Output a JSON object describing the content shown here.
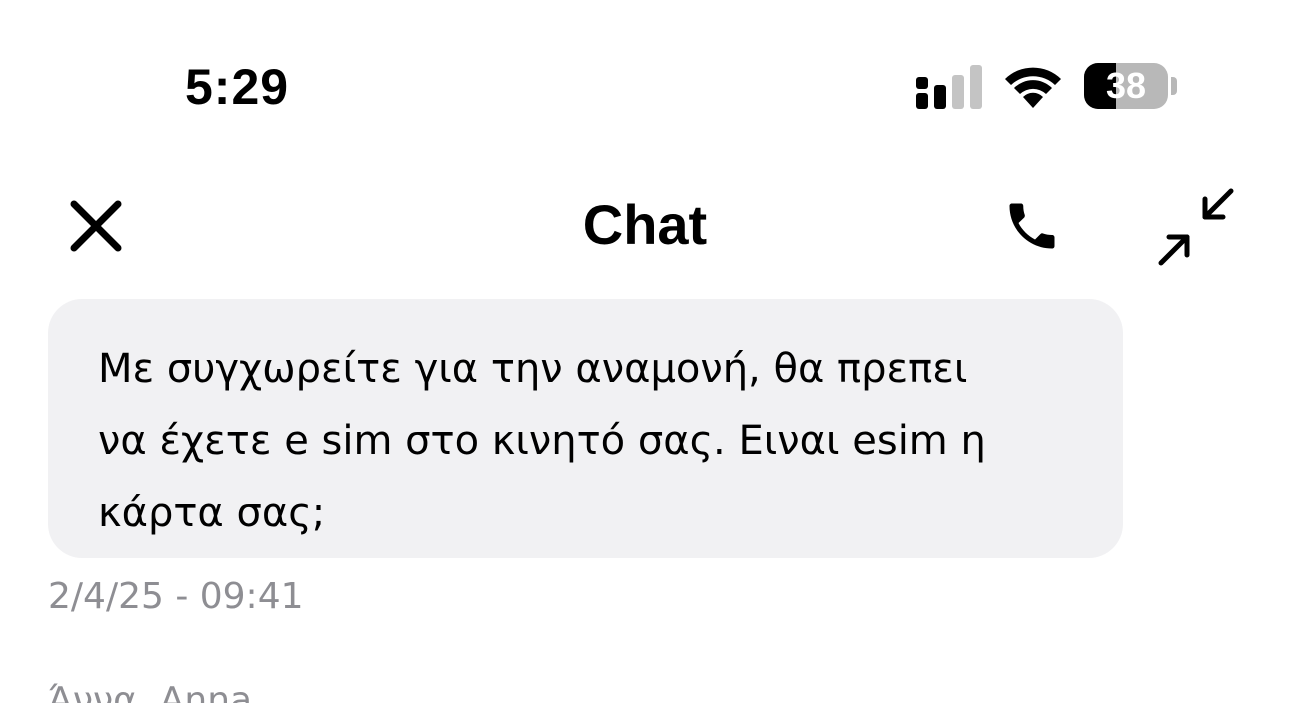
{
  "status_bar": {
    "time": "5:29",
    "battery_percent": "38",
    "battery_level": 0.38,
    "signal_bars_active": 2,
    "signal_bars_total": 4
  },
  "header": {
    "title": "Chat",
    "close_icon": "close-icon",
    "call_icon": "phone-icon",
    "minimize_icon": "collapse-arrows-icon"
  },
  "messages": [
    {
      "text": "Με συγχωρείτε για την αναμονή, θα πρεπει\nνα έχετε e sim στο κινητό σας. Ειναι esim η\nκάρτα σας;",
      "timestamp": "2/4/25 - 09:41"
    }
  ],
  "next_sender": "Άννα, Anna"
}
